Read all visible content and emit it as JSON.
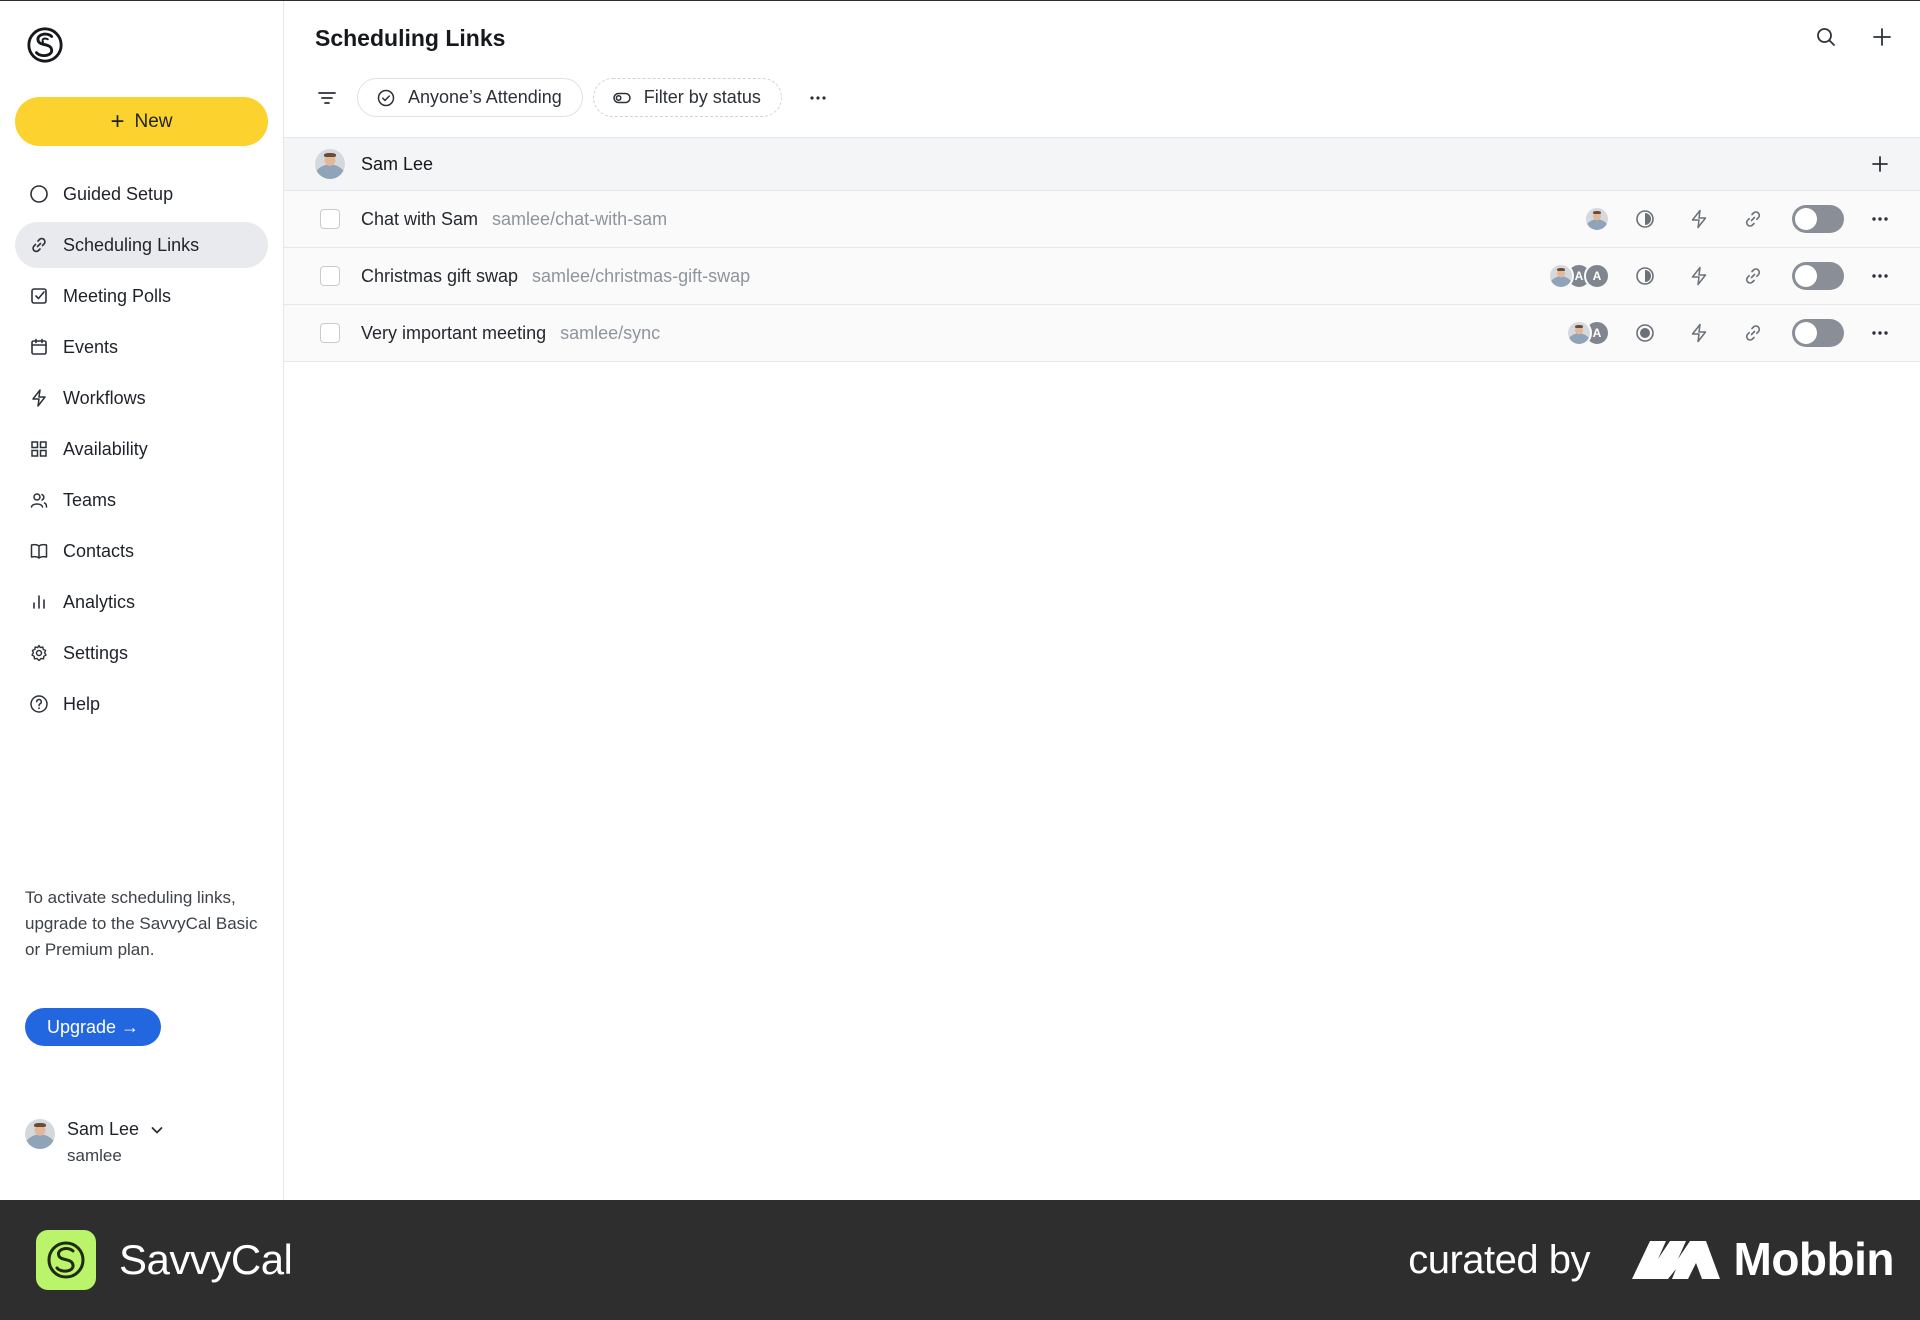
{
  "sidebar": {
    "new_label": "New",
    "items": [
      {
        "label": "Guided Setup",
        "icon": "circle-icon"
      },
      {
        "label": "Scheduling Links",
        "icon": "link-icon",
        "active": true
      },
      {
        "label": "Meeting Polls",
        "icon": "checkbox-icon"
      },
      {
        "label": "Events",
        "icon": "calendar-icon"
      },
      {
        "label": "Workflows",
        "icon": "lightning-icon"
      },
      {
        "label": "Availability",
        "icon": "grid-icon"
      },
      {
        "label": "Teams",
        "icon": "users-icon"
      },
      {
        "label": "Contacts",
        "icon": "book-icon"
      },
      {
        "label": "Analytics",
        "icon": "bar-chart-icon"
      },
      {
        "label": "Settings",
        "icon": "gear-icon"
      },
      {
        "label": "Help",
        "icon": "help-icon"
      }
    ],
    "upgrade_note": "To activate scheduling links, upgrade to the SavvyCal Basic or Premium plan.",
    "upgrade_label": "Upgrade →",
    "user": {
      "name": "Sam Lee",
      "handle": "samlee"
    }
  },
  "main": {
    "title": "Scheduling Links",
    "filters": {
      "attending_label": "Anyone’s Attending",
      "status_label": "Filter by status"
    },
    "group": {
      "name": "Sam Lee"
    },
    "links": [
      {
        "title": "Chat with Sam",
        "slug": "samlee/chat-with-sam",
        "attendees": [],
        "status_icon": "half-circle-icon",
        "enabled": false
      },
      {
        "title": "Christmas gift swap",
        "slug": "samlee/christmas-gift-swap",
        "attendees": [
          "A",
          "A"
        ],
        "status_icon": "half-circle-icon",
        "enabled": false
      },
      {
        "title": "Very important meeting",
        "slug": "samlee/sync",
        "attendees": [
          "A"
        ],
        "status_icon": "filled-circle-icon",
        "enabled": false
      }
    ]
  },
  "banner": {
    "brand": "SavvyCal",
    "curated_by": "curated by",
    "curator": "Mobbin"
  },
  "colors": {
    "accent_yellow": "#fcd22f",
    "upgrade_blue": "#2266e0",
    "banner_bg": "#2e2e2e",
    "brand_green": "#b9f46a"
  }
}
